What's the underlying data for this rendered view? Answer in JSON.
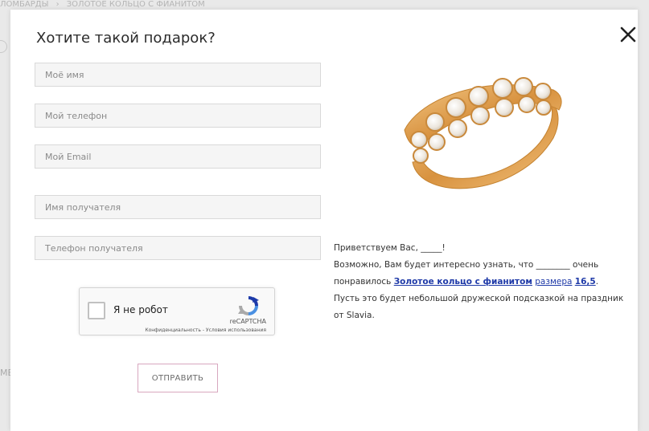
{
  "background": {
    "breadcrumb": [
      "ЛОМБАРДЫ",
      "ЗОЛОТОЕ КОЛЬЦО С ФИАНИТОМ"
    ],
    "left_cut_text": "МЕ"
  },
  "modal": {
    "title": "Хотите такой подарок?",
    "close_icon": "close-x-icon",
    "fields": {
      "name_placeholder": "Моё имя",
      "phone_placeholder": "Мой телефон",
      "email_placeholder": "Мой Email",
      "recipient_name_placeholder": "Имя получателя",
      "recipient_phone_placeholder": "Телефон получателя"
    },
    "captcha": {
      "label": "Я не робот",
      "brand": "reCAPTCHA",
      "links": "Конфиденциальность - Условия использования"
    },
    "submit_label": "ОТПРАВИТЬ",
    "product_image": "gold-ring-with-cubic-zirconia",
    "message": {
      "line1": "Приветствуем Вас, _____!",
      "line2_before": "Возможно, Вам будет интересно узнать, что ________ очень понравилось ",
      "product_link": "Золотое кольцо с фианитом",
      "size_label": "размера",
      "size_value": "16,5",
      "line2_after": ". Пусть это будет небольшой дружеской подсказкой на праздник от Slavia."
    }
  },
  "colors": {
    "link": "#1f3aa8",
    "button_border": "#d8a7bf",
    "field_bg": "#f5f5f5",
    "ring_gold": "#e2a55a"
  }
}
